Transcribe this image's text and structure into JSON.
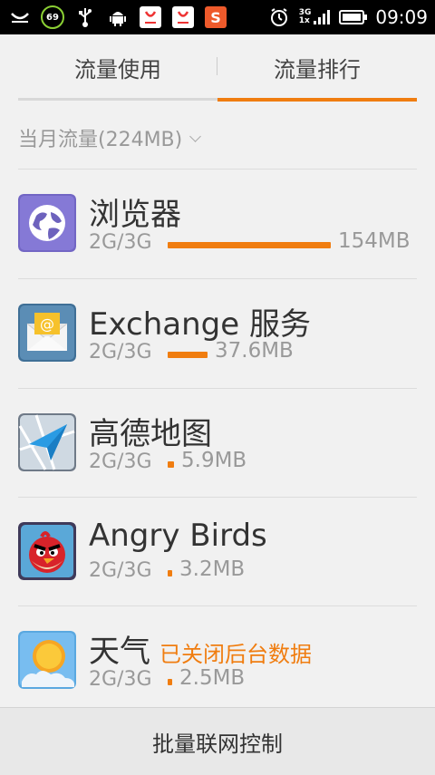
{
  "statusbar": {
    "battery_level": "69",
    "network_top": "3G",
    "network_bottom": "1x",
    "time": "09:09",
    "icons": [
      "notification-icon",
      "battery-saver-icon",
      "usb-icon",
      "android-debug-icon",
      "shopping-bag-icon",
      "shopping-bag-icon",
      "app-s-icon",
      "alarm-icon",
      "signal-icon",
      "battery-icon"
    ]
  },
  "tabs": [
    {
      "label": "流量使用",
      "active": false
    },
    {
      "label": "流量排行",
      "active": true
    }
  ],
  "month_summary": "当月流量(224MB)",
  "apps": [
    {
      "name": "浏览器",
      "network": "2G/3G",
      "usage": "154MB",
      "usage_fraction": 1.0,
      "icon": "browser-globe-icon"
    },
    {
      "name": "Exchange 服务",
      "network": "2G/3G",
      "usage": "37.6MB",
      "usage_fraction": 0.244,
      "icon": "exchange-mail-icon"
    },
    {
      "name": "高德地图",
      "network": "2G/3G",
      "usage": "5.9MB",
      "usage_fraction": 0.038,
      "icon": "gaode-map-icon"
    },
    {
      "name": "Angry Birds",
      "network": "2G/3G",
      "usage": "3.2MB",
      "usage_fraction": 0.021,
      "icon": "angry-birds-icon"
    },
    {
      "name": "天气",
      "note": "已关闭后台数据",
      "network": "2G/3G",
      "usage": "2.5MB",
      "usage_fraction": 0.016,
      "icon": "weather-sun-icon"
    }
  ],
  "bottom_button": "批量联网控制",
  "colors": {
    "accent": "#f07d10",
    "background": "#f1f1f1",
    "statusbar": "#000000"
  }
}
